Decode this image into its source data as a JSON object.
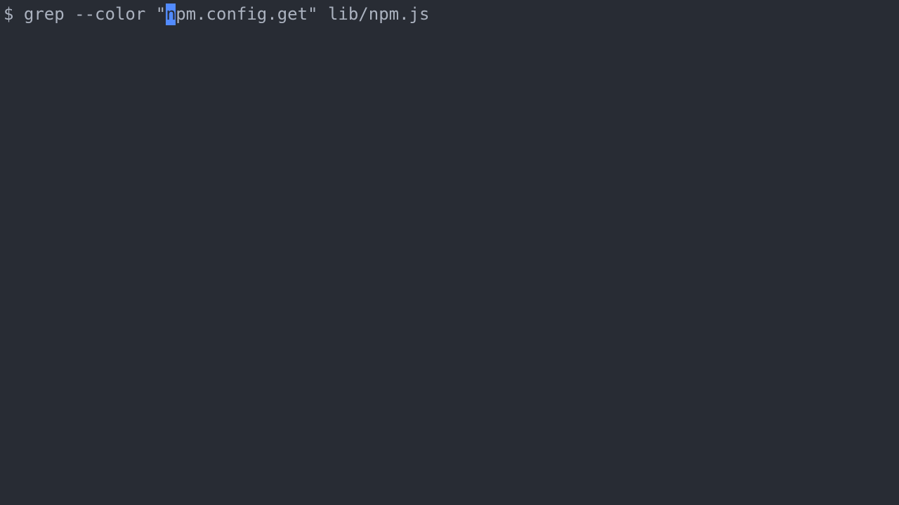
{
  "terminal": {
    "prompt": "$ ",
    "command_before_cursor": "grep --color \"",
    "cursor_char": "n",
    "command_after_cursor": "pm.config.get\" lib/npm.js"
  }
}
